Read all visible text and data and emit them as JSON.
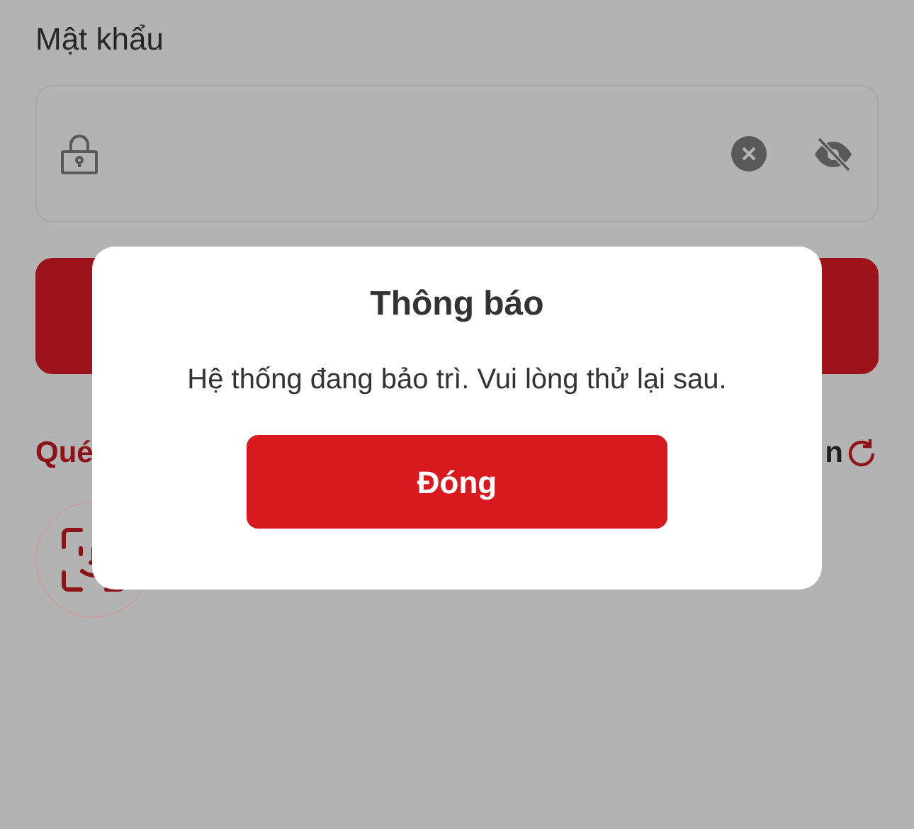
{
  "password_field": {
    "label": "Mật khẩu"
  },
  "options_row": {
    "left_text": "Qué",
    "right_text": "n"
  },
  "dialog": {
    "title": "Thông báo",
    "message": "Hệ thống đang bảo trì. Vui lòng thử lại sau.",
    "button": "Đóng"
  }
}
